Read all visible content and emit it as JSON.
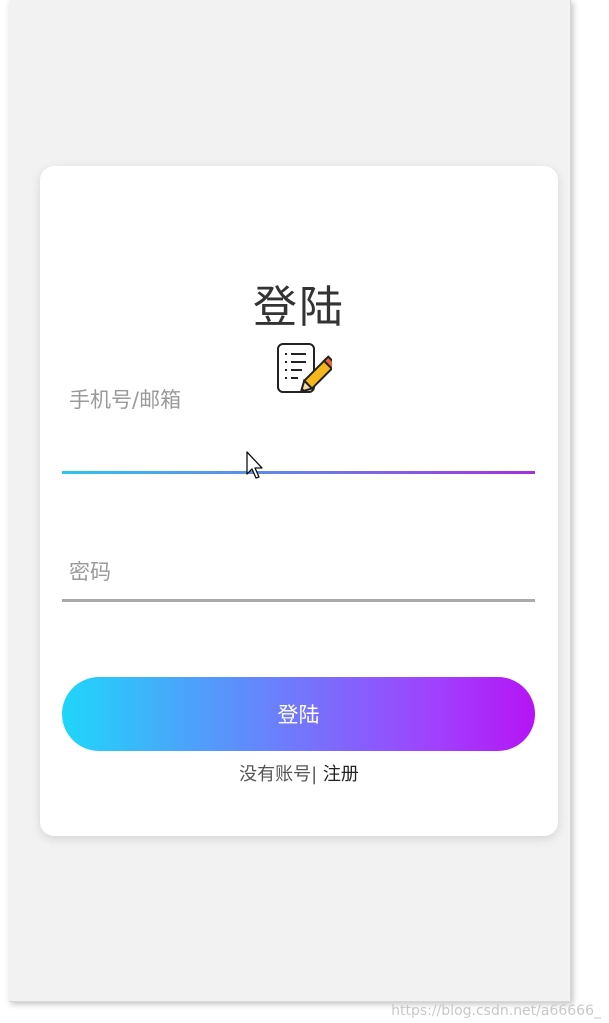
{
  "login": {
    "title": "登陆",
    "username_label": "手机号/邮箱",
    "username_value": "",
    "password_label": "密码",
    "password_value": "",
    "submit_label": "登陆",
    "no_account_text": "没有账号|",
    "register_label": "注册"
  },
  "icons": {
    "title_icon": "notepad-pencil-icon",
    "cursor": "mouse-pointer-icon"
  },
  "colors": {
    "background": "#f2f2f2",
    "card": "#ffffff",
    "gradient_start": "#1fd6f9",
    "gradient_end": "#b514f5",
    "idle_underline": "#aaaaaa",
    "label_gray": "#9a9a9a"
  },
  "watermark": {
    "text": "https://blog.csdn.net/a66666_"
  }
}
